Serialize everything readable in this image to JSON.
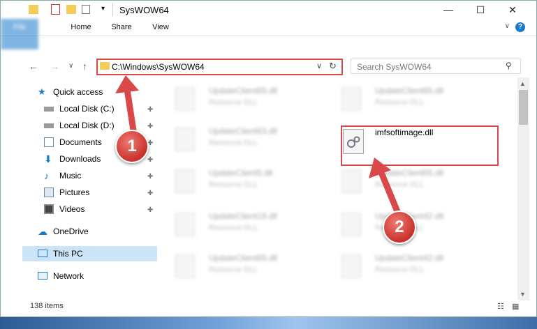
{
  "window": {
    "title": "SysWOW64",
    "minimize_glyph": "—",
    "maximize_glyph": "☐",
    "close_glyph": "✕"
  },
  "ribbon": {
    "tabs": [
      {
        "label": "File"
      },
      {
        "label": "Home"
      },
      {
        "label": "Share"
      },
      {
        "label": "View"
      }
    ],
    "help_glyph": "?",
    "expand_glyph": "∨"
  },
  "navigation": {
    "back_glyph": "←",
    "forward_glyph": "→",
    "recent_glyph": "∨",
    "up_glyph": "↑",
    "address": "C:\\Windows\\SysWOW64",
    "address_dropdown_glyph": "∨",
    "refresh_glyph": "↻",
    "search_placeholder": "Search SysWOW64",
    "search_glyph": "⚲"
  },
  "sidebar": {
    "items": [
      {
        "label": "Quick access",
        "icon": "star-icon",
        "pinned": false
      },
      {
        "label": "Local Disk (C:)",
        "icon": "drive-icon",
        "pinned": true
      },
      {
        "label": "Local Disk (D:)",
        "icon": "drive-icon",
        "pinned": true
      },
      {
        "label": "Documents",
        "icon": "documents-icon",
        "pinned": true
      },
      {
        "label": "Downloads",
        "icon": "downloads-icon",
        "pinned": true
      },
      {
        "label": "Music",
        "icon": "music-icon",
        "pinned": true
      },
      {
        "label": "Pictures",
        "icon": "pictures-icon",
        "pinned": true
      },
      {
        "label": "Videos",
        "icon": "videos-icon",
        "pinned": true
      },
      {
        "label": "OneDrive",
        "icon": "cloud-icon",
        "pinned": false
      },
      {
        "label": "This PC",
        "icon": "computer-icon",
        "pinned": false
      },
      {
        "label": "Network",
        "icon": "network-icon",
        "pinned": false
      }
    ],
    "pin_glyph": "📌"
  },
  "files": [
    {
      "name": "UpdateClient65.dll",
      "type": "Resource DLL"
    },
    {
      "name": "UpdateClient65.dll",
      "type": "Resource DLL"
    },
    {
      "name": "UpdateClient63.dll",
      "type": "Resource DLL"
    },
    {
      "name": "imfsoftimage.dll",
      "type": ""
    },
    {
      "name": "UpdateClient5.dll",
      "type": "Resource DLL"
    },
    {
      "name": "UpdateClient65.dll",
      "type": "Resource DLL"
    },
    {
      "name": "UpdateClient19.dll",
      "type": "Resource DLL"
    },
    {
      "name": "UpdateClient42.dll",
      "type": "Resource DLL"
    },
    {
      "name": "UpdateClient65.dll",
      "type": "Resource DLL"
    },
    {
      "name": "UpdateClient42.dll",
      "type": "Resource DLL"
    }
  ],
  "status": {
    "item_count": "138 items",
    "details_view_glyph": "☷",
    "tiles_view_glyph": "▦"
  },
  "callouts": {
    "one": "1",
    "two": "2"
  },
  "colors": {
    "accent": "#1979ca",
    "callout_red": "#d9494a",
    "folder_yellow": "#f4cc57",
    "selection": "#cce4f7"
  }
}
